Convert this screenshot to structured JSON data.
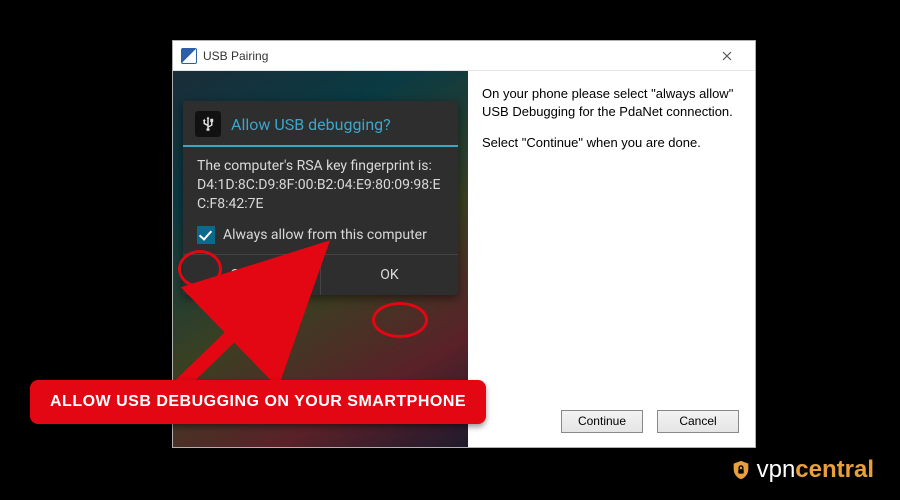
{
  "window": {
    "title": "USB Pairing",
    "close_tooltip": "Close"
  },
  "instructions": {
    "p1": "On your phone please select \"always allow\" USB Debugging for the PdaNet connection.",
    "p2": "Select \"Continue\" when you are done."
  },
  "buttons": {
    "continue": "Continue",
    "cancel": "Cancel"
  },
  "android": {
    "title": "Allow USB debugging?",
    "body_intro": "The computer's RSA key fingerprint is:",
    "fingerprint": "D4:1D:8C:D9:8F:00:B2:04:E9:80:09:98:EC:F8:42:7E",
    "always_allow_label": "Always allow from this computer",
    "always_allow_checked": true,
    "cancel": "Cancel",
    "ok": "OK"
  },
  "annotation": {
    "callout": "Allow USB debugging on your smartphone"
  },
  "brand": {
    "vpn": "vpn",
    "central": "central"
  }
}
